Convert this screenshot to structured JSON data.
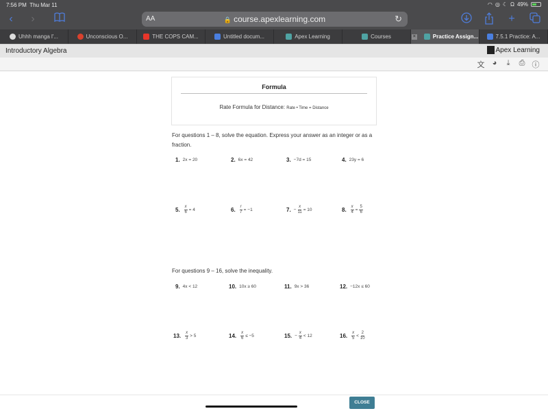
{
  "status_bar": {
    "time": "7:56 PM",
    "date": "Thu Mar 11",
    "battery": "49%",
    "battery_level": 0.49
  },
  "browser": {
    "text_size_label": "AA",
    "url": "course.apexlearning.com",
    "tabs": [
      {
        "label": "Uhhh manga l'...",
        "icon": "reddit-icon",
        "active": false
      },
      {
        "label": "Unconscious O...",
        "icon": "skull-icon",
        "active": false
      },
      {
        "label": "THE COPS CAM...",
        "icon": "youtube-icon",
        "active": false
      },
      {
        "label": "Untitled docum...",
        "icon": "docs-icon",
        "active": false
      },
      {
        "label": "Apex Learning",
        "icon": "apex-icon",
        "active": false
      },
      {
        "label": "Courses",
        "icon": "apex-icon",
        "active": false
      },
      {
        "label": "Practice Assign...",
        "icon": "apex-icon",
        "active": true
      },
      {
        "label": "7.5.1 Practice: A...",
        "icon": "docs-icon",
        "active": false
      }
    ],
    "colors": {
      "accent": "#4f7ddb",
      "chrome": "#4a4a4c"
    }
  },
  "header": {
    "course_title": "Introductory Algebra",
    "brand": "Apex Learning"
  },
  "tools": [
    "translate-icon",
    "read-aloud-icon",
    "download-icon",
    "print-icon",
    "help-icon"
  ],
  "formula": {
    "title": "Formula",
    "label": "Rate Formula for Distance:",
    "equation": "Rate • Time = Distance"
  },
  "section1": {
    "instructions": "For questions 1 – 8, solve the equation. Express your answer as an integer or as a fraction.",
    "questions": [
      {
        "num": "1.",
        "expr": "2x = 20"
      },
      {
        "num": "2.",
        "expr": "6x = 42"
      },
      {
        "num": "3.",
        "expr": "−7d = 15"
      },
      {
        "num": "4.",
        "expr": "23y = 6"
      },
      {
        "num": "5.",
        "pre": "",
        "frac_num": "x",
        "frac_den": "6",
        "post": "= 4"
      },
      {
        "num": "6.",
        "pre": "",
        "frac_num": "r",
        "frac_den": "7",
        "post": "= −1"
      },
      {
        "num": "7.",
        "pre": "−",
        "frac_num": "x",
        "frac_den": "11",
        "post": "= 10"
      },
      {
        "num": "8.",
        "pre": "",
        "frac_num": "x",
        "frac_den": "4",
        "post": "=",
        "frac2_num": "5",
        "frac2_den": "6"
      }
    ]
  },
  "section2": {
    "instructions": "For questions 9 – 16, solve the inequality.",
    "questions": [
      {
        "num": "9.",
        "expr": "4x < 12"
      },
      {
        "num": "10.",
        "expr": "10x ≥ 60"
      },
      {
        "num": "11.",
        "expr": "9x > 36"
      },
      {
        "num": "12.",
        "expr": "−12x ≤ 60"
      },
      {
        "num": "13.",
        "pre": "",
        "frac_num": "x",
        "frac_den": "3",
        "post": "> 5"
      },
      {
        "num": "14.",
        "pre": "",
        "frac_num": "x",
        "frac_den": "6",
        "post": "≤ −5"
      },
      {
        "num": "15.",
        "pre": "−",
        "frac_num": "x",
        "frac_den": "4",
        "post": "< 12"
      },
      {
        "num": "16.",
        "pre": "",
        "frac_num": "x",
        "frac_den": "5",
        "post": "<",
        "frac2_num": "2",
        "frac2_den": "10"
      }
    ]
  },
  "footer": {
    "close_label": "CLOSE",
    "close_color": "#3f7e94"
  }
}
